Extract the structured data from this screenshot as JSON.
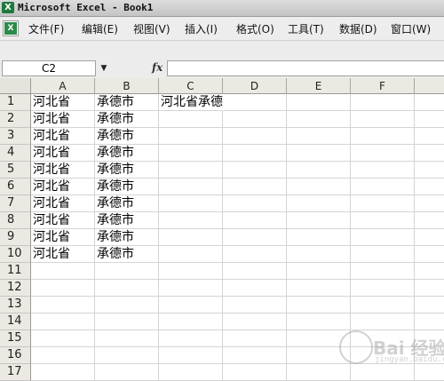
{
  "window": {
    "title": "Microsoft Excel - Book1",
    "app_icon": "excel-icon"
  },
  "menu": {
    "items": [
      "文件(F)",
      "编辑(E)",
      "视图(V)",
      "插入(I)",
      "格式(O)",
      "工具(T)",
      "数据(D)",
      "窗口(W)"
    ]
  },
  "formula_bar": {
    "name_box": "C2",
    "fx_label": "fx",
    "formula": ""
  },
  "sheet": {
    "columns": [
      "A",
      "B",
      "C",
      "D",
      "E",
      "F"
    ],
    "rows": [
      "1",
      "2",
      "3",
      "4",
      "5",
      "6",
      "7",
      "8",
      "9",
      "10",
      "11",
      "12",
      "13",
      "14",
      "15",
      "16",
      "17"
    ],
    "cells": [
      [
        "河北省",
        "承德市",
        "河北省承德市"
      ],
      [
        "河北省",
        "承德市",
        ""
      ],
      [
        "河北省",
        "承德市",
        ""
      ],
      [
        "河北省",
        "承德市",
        ""
      ],
      [
        "河北省",
        "承德市",
        ""
      ],
      [
        "河北省",
        "承德市",
        ""
      ],
      [
        "河北省",
        "承德市",
        ""
      ],
      [
        "河北省",
        "承德市",
        ""
      ],
      [
        "河北省",
        "承德市",
        ""
      ],
      [
        "河北省",
        "承德市",
        ""
      ]
    ]
  },
  "watermark": {
    "text": "Bai 经验",
    "sub": "jingyan.baidu.com"
  }
}
